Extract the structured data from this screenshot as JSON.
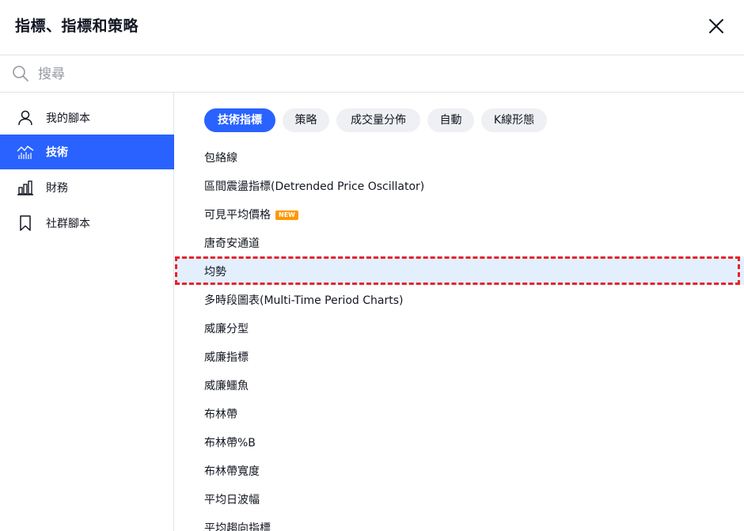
{
  "dialog": {
    "title": "指標、指標和策略",
    "close_icon": "close-icon"
  },
  "search": {
    "placeholder": "搜尋",
    "value": "",
    "icon": "search-icon"
  },
  "sidebar": {
    "items": [
      {
        "label": "我的腳本",
        "icon": "person-icon",
        "active": false
      },
      {
        "label": "技術",
        "icon": "chart-line-icon",
        "active": true
      },
      {
        "label": "財務",
        "icon": "bar-chart-icon",
        "active": false
      },
      {
        "label": "社群腳本",
        "icon": "bookmark-icon",
        "active": false
      }
    ]
  },
  "chips": [
    {
      "label": "技術指標",
      "active": true
    },
    {
      "label": "策略",
      "active": false
    },
    {
      "label": "成交量分佈",
      "active": false
    },
    {
      "label": "自動",
      "active": false
    },
    {
      "label": "K線形態",
      "active": false
    }
  ],
  "list": [
    {
      "label": "包絡線"
    },
    {
      "label": "區間震盪指標(Detrended Price Oscillator)"
    },
    {
      "label": "可見平均價格",
      "badge": "NEW"
    },
    {
      "label": "唐奇安通道"
    },
    {
      "label": "均勢",
      "highlighted": true
    },
    {
      "label": "多時段圖表(Multi-Time Period Charts)"
    },
    {
      "label": "威廉分型"
    },
    {
      "label": "威廉指標"
    },
    {
      "label": "威廉鱷魚"
    },
    {
      "label": "布林帶"
    },
    {
      "label": "布林帶%B"
    },
    {
      "label": "布林帶寬度"
    },
    {
      "label": "平均日波幅"
    },
    {
      "label": "平均趨向指標"
    }
  ],
  "colors": {
    "accent": "#2962ff",
    "badge": "#ff9800",
    "highlight_row": "#e3effd",
    "annotation_dash": "#e8232a"
  }
}
